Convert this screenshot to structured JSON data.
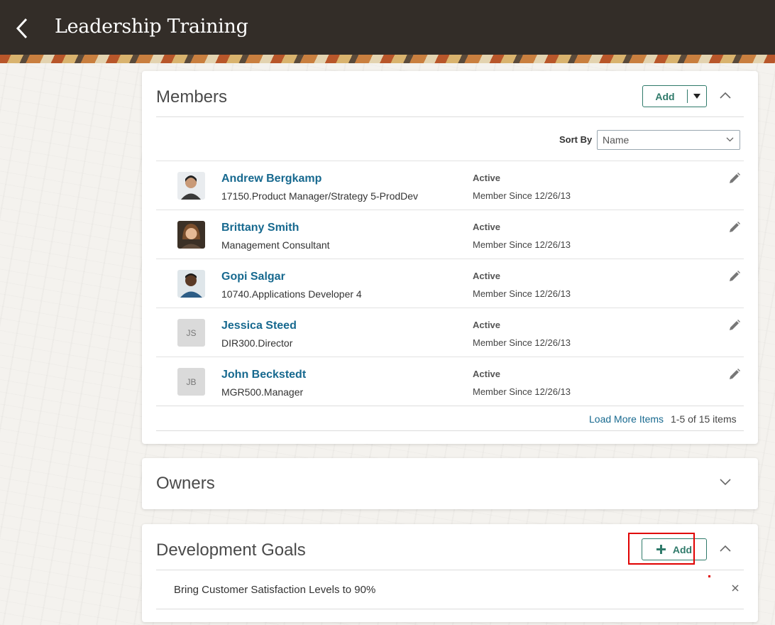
{
  "header": {
    "title": "Leadership Training"
  },
  "members": {
    "title": "Members",
    "add_label": "Add",
    "sort_label": "Sort By",
    "sort_value": "Name",
    "items": [
      {
        "name": "Andrew Bergkamp",
        "title": "17150.Product Manager/Strategy 5-ProdDev",
        "status": "Active",
        "since": "Member Since 12/26/13",
        "initials": ""
      },
      {
        "name": "Brittany Smith",
        "title": "Management Consultant",
        "status": "Active",
        "since": "Member Since 12/26/13",
        "initials": ""
      },
      {
        "name": "Gopi Salgar",
        "title": "10740.Applications Developer 4",
        "status": "Active",
        "since": "Member Since 12/26/13",
        "initials": ""
      },
      {
        "name": "Jessica Steed",
        "title": "DIR300.Director",
        "status": "Active",
        "since": "Member Since 12/26/13",
        "initials": "JS"
      },
      {
        "name": "John Beckstedt",
        "title": "MGR500.Manager",
        "status": "Active",
        "since": "Member Since 12/26/13",
        "initials": "JB"
      }
    ],
    "load_more": "Load More Items",
    "count": "1-5 of 15 items"
  },
  "owners": {
    "title": "Owners"
  },
  "goals": {
    "title": "Development Goals",
    "add_label": "Add",
    "items": [
      {
        "text": "Bring Customer Satisfaction Levels to 90%"
      }
    ]
  },
  "colors": {
    "accent": "#2f7a6a",
    "link": "#17698f",
    "header_bg": "#332d28",
    "highlight": "#e00000"
  }
}
